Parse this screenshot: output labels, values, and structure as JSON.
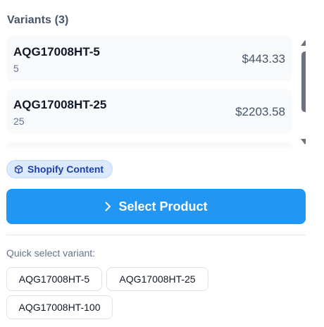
{
  "variants": {
    "heading": "Variants (3)",
    "items": [
      {
        "sku": "AQG17008HT-5",
        "qty": "5",
        "price": "$443.33"
      },
      {
        "sku": "AQG17008HT-25",
        "qty": "25",
        "price": "$2203.58"
      }
    ]
  },
  "badge": {
    "label": "Shopify Content",
    "icon": "cube-icon"
  },
  "select_button": {
    "label": "Select Product",
    "icon": "chevron-right-icon"
  },
  "quick_select": {
    "label": "Quick select variant:",
    "options": [
      "AQG17008HT-5",
      "AQG17008HT-25",
      "AQG17008HT-100"
    ]
  },
  "colors": {
    "primary": "#2196f3",
    "badge_bg": "#dbeafe",
    "badge_text": "#1e40af",
    "card_bg": "#f8fafc"
  }
}
